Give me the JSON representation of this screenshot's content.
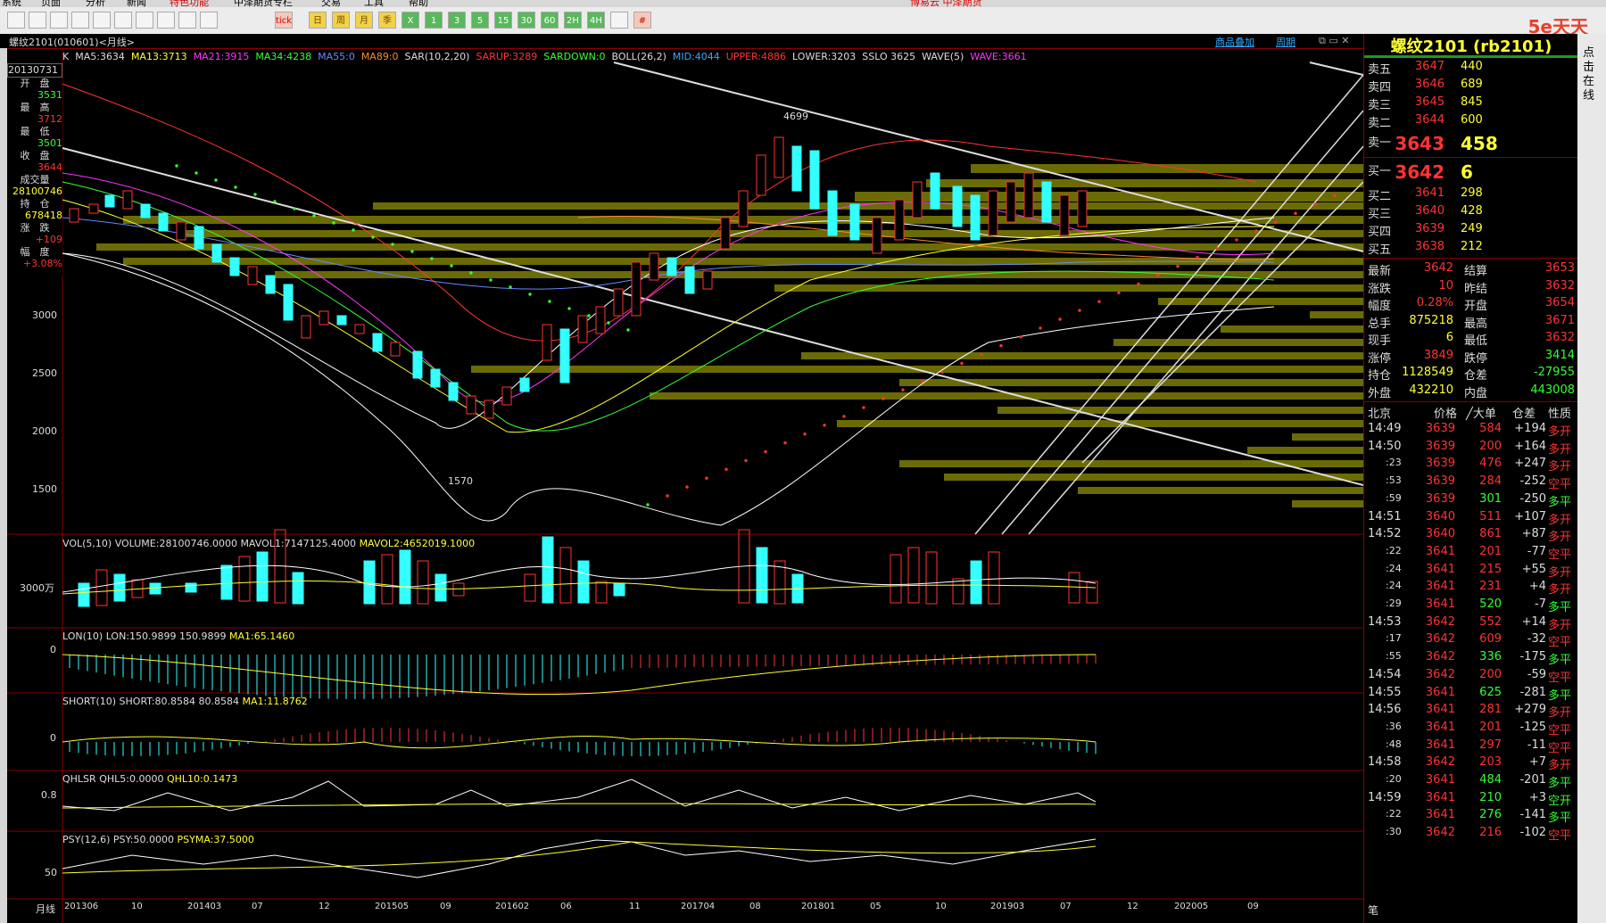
{
  "menu": [
    "系统",
    "页面",
    "分析",
    "新闻",
    "特色功能",
    "中泽期货专栏",
    "交易",
    "工具",
    "帮助"
  ],
  "menu_center": "博易云 中泽期货",
  "toolbar": {
    "icons": [
      "back-icon",
      "home-icon",
      "chart-icon",
      "search-icon",
      "zoom-in-icon",
      "zoom-out-icon",
      "pencil-icon",
      "draw-icon",
      "grid-icon",
      "line-icon",
      "tick-icon",
      "day-icon",
      "week-icon",
      "month-icon",
      "quarter-icon",
      "x-icon",
      "1m-icon",
      "3m-icon",
      "5m-icon",
      "15m-icon",
      "30m-icon",
      "60m-icon",
      "2h-icon",
      "4h-icon",
      "clock-icon",
      "grid2-icon"
    ],
    "labels": [
      "",
      "",
      "",
      "",
      "",
      "",
      "",
      "",
      "",
      "",
      "tick",
      "日",
      "周",
      "月",
      "季",
      "X",
      "1",
      "3",
      "5",
      "15",
      "30",
      "60",
      "2H",
      "4H",
      "",
      "#"
    ]
  },
  "header": {
    "symbol": "螺纹2101(010601)<月线>",
    "overlay_btn": "商品叠加",
    "period_btn": "周期"
  },
  "indicators": {
    "k": "K",
    "ma5": "MA5:3634",
    "ma13": "MA13:3713",
    "ma21": "MA21:3915",
    "ma34": "MA34:4238",
    "ma55": "MA55:0",
    "ma89": "MA89:0",
    "sar": "SAR(10,2,20)",
    "sarup": "SARUP:3289",
    "sardown": "SARDOWN:0",
    "boll": "BOLL(26,2)",
    "mid": "MID:4044",
    "upper": "UPPER:4886",
    "lower": "LOWER:3203",
    "sslo": "SSLO 3625",
    "wave": "WAVE(5)",
    "waveval": "WAVE:3661"
  },
  "info_box": {
    "date": "20130731",
    "open_label": "开　盘",
    "open": "3531",
    "high_label": "最　高",
    "high": "3712",
    "low_label": "最　低",
    "low": "3501",
    "close_label": "收　盘",
    "close": "3644",
    "vol_label": "成交量",
    "vol": "28100746",
    "oi_label": "持　仓",
    "oi": "678418",
    "chg_label": "涨　跌",
    "chg": "+109",
    "pct_label": "幅　度",
    "pct": "+3.08%"
  },
  "price_axis": [
    "3000",
    "2500",
    "2000",
    "1500"
  ],
  "annotations": {
    "high": "4699",
    "low": "1570"
  },
  "volume": {
    "title": "VOL(5,10) VOLUME:28100746.0000",
    "mavol1": "MAVOL1:7147125.4000",
    "mavol2": "MAVOL2:4652019.1000",
    "axis": "3000万"
  },
  "lon": {
    "title": "LON(10) LON:150.9899",
    "val": "150.9899",
    "ma": "MA1:65.1460",
    "axis": "0"
  },
  "short": {
    "title": "SHORT(10) SHORT:80.8584",
    "val": "80.8584",
    "ma": "MA1:11.8762",
    "axis": "0"
  },
  "qhlsr": {
    "title": "QHLSR",
    "qhl5": "QHL5:0.0000",
    "qhl10": "QHL10:0.1473",
    "axis": "0.8"
  },
  "psy": {
    "title": "PSY(12,6)",
    "val": "PSY:50.0000",
    "ma": "PSYMA:37.5000",
    "axis": "50"
  },
  "xaxis": {
    "label": "月线",
    "ticks": [
      "201306",
      "10",
      "201403",
      "07",
      "12",
      "201505",
      "09",
      "201602",
      "06",
      "11",
      "201704",
      "08",
      "201801",
      "05",
      "10",
      "201903",
      "07",
      "12",
      "202005",
      "09"
    ]
  },
  "quote": {
    "title": "螺纹2101 (rb2101)",
    "asks": [
      [
        "卖五",
        "3647",
        "440"
      ],
      [
        "卖四",
        "3646",
        "689"
      ],
      [
        "卖三",
        "3645",
        "845"
      ],
      [
        "卖二",
        "3644",
        "600"
      ]
    ],
    "ask1": [
      "卖一",
      "3643",
      "458"
    ],
    "bid1": [
      "买一",
      "3642",
      "6"
    ],
    "bids": [
      [
        "买二",
        "3641",
        "298"
      ],
      [
        "买三",
        "3640",
        "428"
      ],
      [
        "买四",
        "3639",
        "249"
      ],
      [
        "买五",
        "3638",
        "212"
      ]
    ],
    "stats": [
      [
        "最新",
        "3642",
        "结算",
        "3653"
      ],
      [
        "涨跌",
        "10",
        "昨结",
        "3632"
      ],
      [
        "幅度",
        "0.28%",
        "开盘",
        "3654"
      ],
      [
        "总手",
        "875218",
        "最高",
        "3671"
      ],
      [
        "现手",
        "6",
        "最低",
        "3632"
      ],
      [
        "涨停",
        "3849",
        "跌停",
        "3414"
      ],
      [
        "持仓",
        "1128549",
        "仓差",
        "-27955"
      ],
      [
        "外盘",
        "432210",
        "内盘",
        "443008"
      ]
    ],
    "tick_header": [
      "北京",
      "价格",
      "╱大单",
      "仓差",
      "性质"
    ],
    "ticks": [
      [
        "14:49",
        "3639",
        "584",
        "+194",
        "多开"
      ],
      [
        "14:50",
        "3639",
        "200",
        "+164",
        "多开"
      ],
      [
        ":23",
        "3639",
        "476",
        "+247",
        "多开"
      ],
      [
        ":53",
        "3639",
        "284",
        "-252",
        "空平"
      ],
      [
        ":59",
        "3639",
        "301",
        "-250",
        "多平"
      ],
      [
        "14:51",
        "3640",
        "511",
        "+107",
        "多开"
      ],
      [
        "14:52",
        "3640",
        "861",
        "+87",
        "多开"
      ],
      [
        ":22",
        "3641",
        "201",
        "-77",
        "空平"
      ],
      [
        ":24",
        "3641",
        "215",
        "+55",
        "多开"
      ],
      [
        ":24",
        "3641",
        "231",
        "+4",
        "多开"
      ],
      [
        ":29",
        "3641",
        "520",
        "-7",
        "多平"
      ],
      [
        "14:53",
        "3642",
        "552",
        "+14",
        "多开"
      ],
      [
        ":17",
        "3642",
        "609",
        "-32",
        "空平"
      ],
      [
        ":55",
        "3642",
        "336",
        "-175",
        "多平"
      ],
      [
        "14:54",
        "3642",
        "200",
        "-59",
        "空平"
      ],
      [
        "14:55",
        "3641",
        "625",
        "-281",
        "多平"
      ],
      [
        "14:56",
        "3641",
        "281",
        "+279",
        "多开"
      ],
      [
        ":36",
        "3641",
        "201",
        "-125",
        "空平"
      ],
      [
        ":48",
        "3641",
        "297",
        "-11",
        "空平"
      ],
      [
        "14:58",
        "3642",
        "203",
        "+7",
        "多开"
      ],
      [
        ":20",
        "3641",
        "484",
        "-201",
        "多平"
      ],
      [
        "14:59",
        "3641",
        "210",
        "+3",
        "空开"
      ],
      [
        ":22",
        "3641",
        "276",
        "-141",
        "多平"
      ],
      [
        ":30",
        "3642",
        "216",
        "-102",
        "空平"
      ]
    ],
    "footer": "笔"
  },
  "side_tab": "点击在线"
}
